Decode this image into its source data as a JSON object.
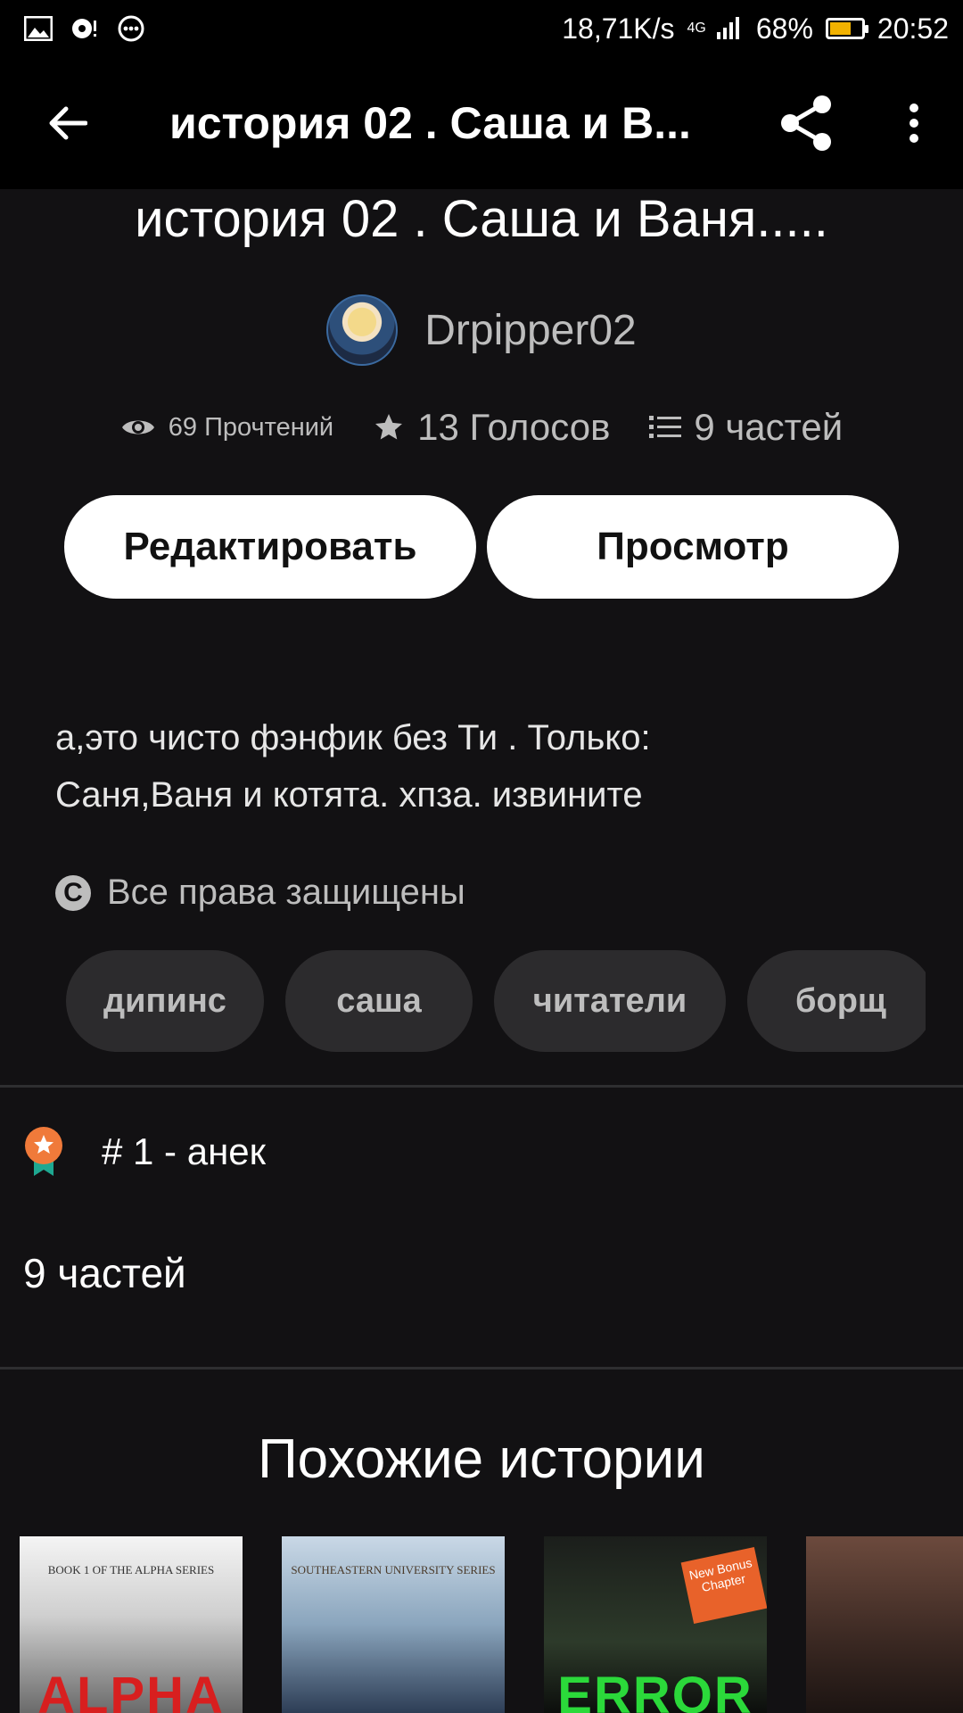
{
  "status_bar": {
    "network_speed": "18,71K/s",
    "network_type": "4G",
    "battery_percent": "68%",
    "battery_level": 0.68,
    "time": "20:52",
    "icons": [
      "image-icon",
      "mic-icon",
      "chat-icon",
      "signal-icon",
      "battery-icon"
    ]
  },
  "appbar": {
    "title": "история 02 . Саша и В...",
    "back_icon": "arrow-left-icon",
    "share_icon": "share-icon",
    "more_icon": "more-vertical-icon"
  },
  "story": {
    "title": "история 02 . Саша и Ваня.....",
    "author": "Drpipper02",
    "stats": {
      "reads": "69 Прочтений",
      "votes": "13 Голосов",
      "parts": "9 частей"
    },
    "buttons": {
      "edit": "Редактировать",
      "view": "Просмотр"
    },
    "description_line1": "а,это чисто фэнфик без Ти . Только:",
    "description_line2": "Саня,Ваня и котята. хпза. извините",
    "rights": "Все права защищены",
    "tags": [
      "дипинс",
      "саша",
      "читатели",
      "борщ"
    ],
    "rank": "# 1 - анек",
    "parts_count": "9 частей"
  },
  "similar": {
    "title": "Похожие истории",
    "covers": [
      {
        "series": "BOOK 1 OF THE ALPHA SERIES",
        "big": "ALPHA",
        "color": "#d81f1f"
      },
      {
        "series": "SOUTHEASTERN UNIVERSITY SERIES",
        "big": "",
        "color": "#ffffff"
      },
      {
        "series": "",
        "big": "ERROR",
        "color": "#2bd93a",
        "badge": "New Bonus Chapter"
      },
      {
        "series": "",
        "big": "",
        "color": "#ffffff"
      }
    ]
  },
  "colors": {
    "background": "#121113",
    "bar": "#000000",
    "muted_text": "#bdbdbd",
    "pill": "#2c2b2d",
    "rank_orange": "#f07a3a",
    "rank_ribbon": "#1ea891"
  }
}
